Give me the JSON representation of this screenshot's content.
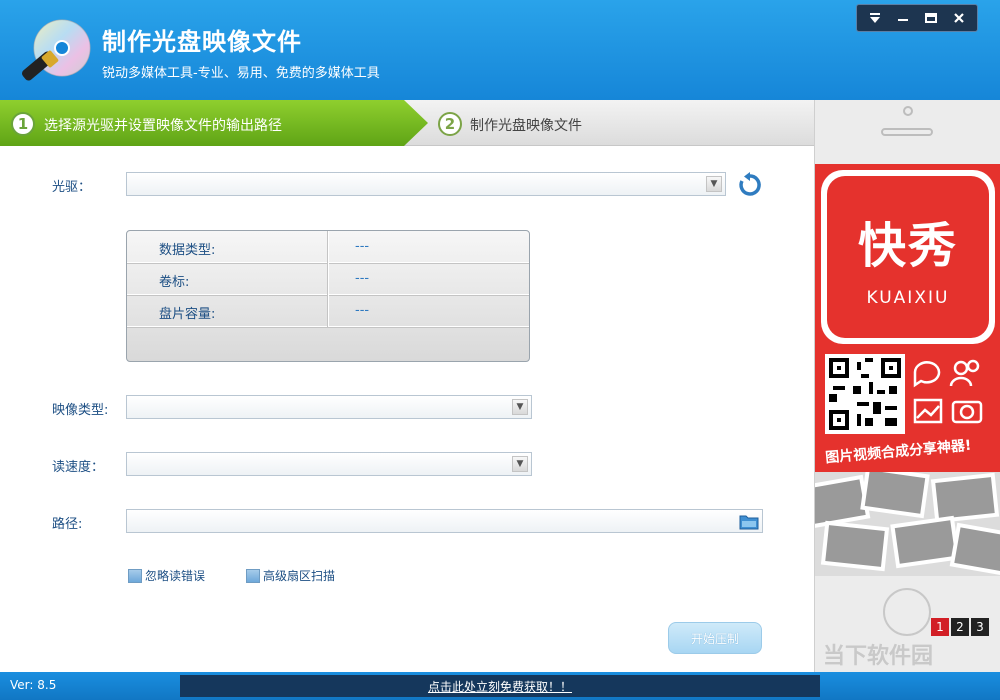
{
  "header": {
    "title": "制作光盘映像文件",
    "subtitle": "锐动多媒体工具-专业、易用、免费的多媒体工具",
    "controls": {
      "dropdown_icon": "triangle-down-icon",
      "minimize_icon": "minimize-icon",
      "maximize_icon": "maximize-icon",
      "close_icon": "close-icon"
    }
  },
  "steps": [
    {
      "num": "1",
      "label": "选择源光驱并设置映像文件的输出路径",
      "active": true
    },
    {
      "num": "2",
      "label": "制作光盘映像文件",
      "active": false
    }
  ],
  "form": {
    "drive_label": "光驱：",
    "drive_value": "",
    "info": [
      {
        "key": "数据类型:",
        "value": "---"
      },
      {
        "key": "卷标:",
        "value": "---"
      },
      {
        "key": "盘片容量:",
        "value": "---"
      }
    ],
    "image_type_label": "映像类型:",
    "image_type_value": "",
    "read_speed_label": "读速度：",
    "read_speed_value": "",
    "path_label": "路径:",
    "path_value": "",
    "ignore_errors_label": "忽略读错误",
    "advanced_scan_label": "高级扇区扫描",
    "start_button": "开始压制"
  },
  "ad": {
    "brand_cn": "快秀",
    "brand_en": "KUAIXIU",
    "slogan": "图片视频合成分享神器!",
    "pages": [
      "1",
      "2",
      "3"
    ],
    "active_page": "1",
    "watermark": "当下软件园"
  },
  "status": {
    "version": "Ver: 8.5",
    "promo_link": "点击此处立刻免费获取！！"
  },
  "colors": {
    "header_blue": "#1686d8",
    "step_green": "#7cbf25",
    "ad_red": "#e5322d",
    "status_blue": "#1177c4"
  }
}
